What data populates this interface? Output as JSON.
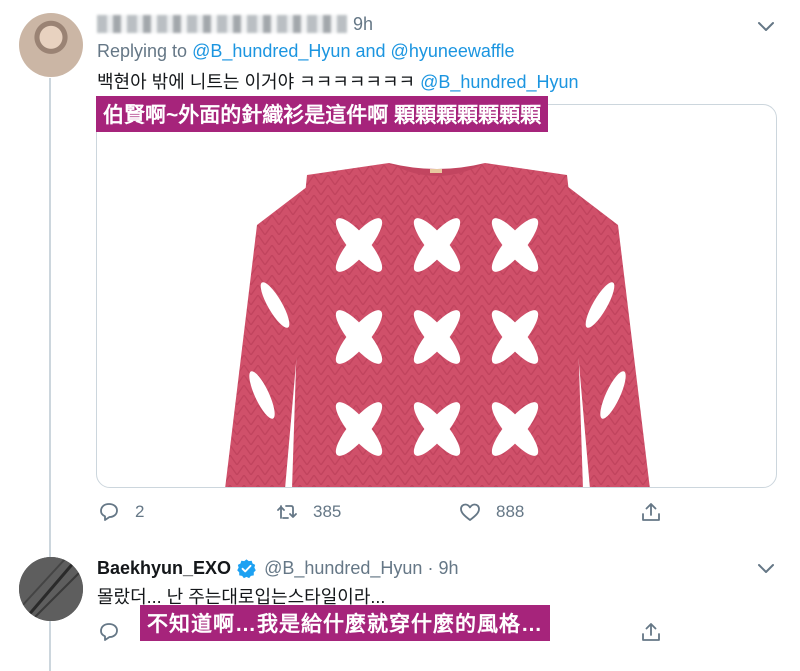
{
  "tweet1": {
    "time": "9h",
    "replying_prefix": "Replying to",
    "reply_to_1": "@B_hundred_Hyun",
    "reply_and": "and",
    "reply_to_2": "@hyuneewaffle",
    "text": "백현아 밖에 니트는 이거야 ㅋㅋㅋㅋㅋㅋㅋ",
    "text_mention": "@B_hundred_Hyun",
    "subtitle": "伯賢啊~外面的針織衫是這件啊 顆顆顆顆顆顆顆",
    "replies": "2",
    "retweets": "385",
    "likes": "888"
  },
  "tweet2": {
    "name": "Baekhyun_EXO",
    "handle": "@B_hundred_Hyun",
    "separator": "·",
    "time": "9h",
    "text": "몰랐더... 난 주는대로입는스타일이라...",
    "subtitle": "不知道啊…我是給什麼就穿什麼的風格…"
  },
  "colors": {
    "accent": "#1b95e0",
    "muted": "#657786",
    "subtitle_bg": "#a6247b",
    "sweater": "#d0506a"
  },
  "icons": [
    "reply-icon",
    "retweet-icon",
    "like-icon",
    "share-icon",
    "chevron-down-icon",
    "verified-badge-icon"
  ]
}
